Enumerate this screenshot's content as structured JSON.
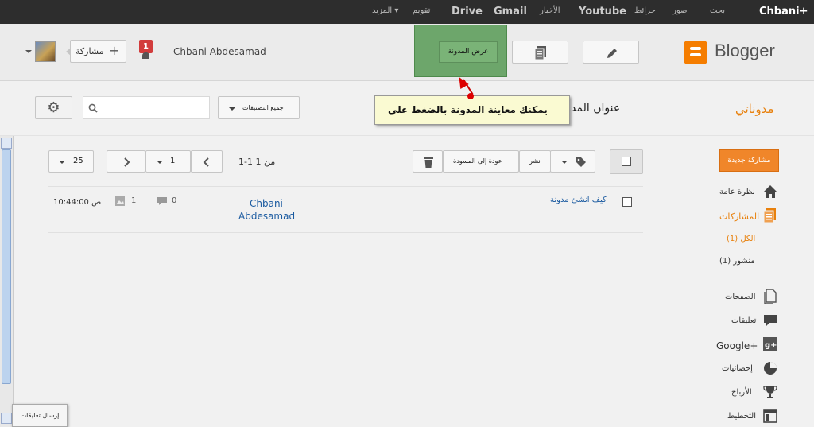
{
  "topbar": {
    "account": "Chbani+",
    "search": "بحث",
    "images": "صور",
    "maps": "خرائط",
    "youtube": "Youtube",
    "news": "الأخبار",
    "gmail": "Gmail",
    "drive": "Drive",
    "calendar": "تقويم",
    "more": "المزيد ▾"
  },
  "header": {
    "share_label": "مشاركة",
    "share_plus": "+",
    "notification_count": "1",
    "user_name": "Chbani Abdesamad",
    "view_blog_label": "عرض المدونة",
    "logo_text": "Blogger"
  },
  "bar2": {
    "my_blogs": "مدوناتي",
    "blog_title": "عنوان المدونة",
    "tooltip": "يمكنك معاينة المدونة بالضغط على",
    "sort_label": "جميع التصنيفات"
  },
  "toolbar": {
    "publish": "نشر",
    "revert": "عودة إلى المسودة",
    "page_info": "1-1 من 1",
    "page_num": "1",
    "per_page": "25"
  },
  "posts": [
    {
      "title": "كيف انشئ مدونة",
      "author_line1": "Chbani",
      "author_line2": "Abdesamad",
      "comments": "0",
      "views": "1",
      "time": "10:44:00 ص"
    }
  ],
  "sidebar": {
    "new_post": "مشاركة جديدة",
    "overview": "نظرة عامة",
    "posts": "المشاركات",
    "all": "الكل (1)",
    "published": "منشور (1)",
    "pages": "الصفحات",
    "comments": "تعليقات",
    "google_plus": "Google+",
    "stats": "إحصائيات",
    "earnings": "الأرباح",
    "layout": "التخطيط"
  },
  "feedback": "إرسال تعليقات",
  "colors": {
    "accent": "#e8800c",
    "link": "#1a5aa0",
    "highlight": "#6da66b",
    "tooltip": "#fafad2"
  }
}
